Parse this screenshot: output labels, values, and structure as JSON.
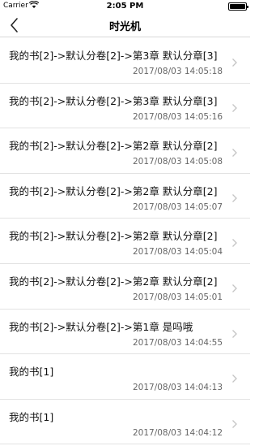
{
  "status_bar": {
    "carrier": "Carrier",
    "time": "2:05 PM"
  },
  "nav": {
    "title": "时光机"
  },
  "rows": [
    {
      "name": "我的书[2]->默认分卷[2]->第3章 默认分章[3]",
      "stamp": "2017/08/03 14:05:18"
    },
    {
      "name": "我的书[2]->默认分卷[2]->第3章 默认分章[3]",
      "stamp": "2017/08/03 14:05:16"
    },
    {
      "name": "我的书[2]->默认分卷[2]->第2章 默认分章[2]",
      "stamp": "2017/08/03 14:05:08"
    },
    {
      "name": "我的书[2]->默认分卷[2]->第2章 默认分章[2]",
      "stamp": "2017/08/03 14:05:07"
    },
    {
      "name": "我的书[2]->默认分卷[2]->第2章 默认分章[2]",
      "stamp": "2017/08/03 14:05:04"
    },
    {
      "name": "我的书[2]->默认分卷[2]->第2章 默认分章[2]",
      "stamp": "2017/08/03 14:05:01"
    },
    {
      "name": "我的书[2]->默认分卷[2]->第1章 是吗哦",
      "stamp": "2017/08/03 14:04:55"
    },
    {
      "name": "我的书[1]",
      "stamp": "2017/08/03 14:04:13"
    },
    {
      "name": "我的书[1]",
      "stamp": "2017/08/03 14:04:12"
    }
  ]
}
